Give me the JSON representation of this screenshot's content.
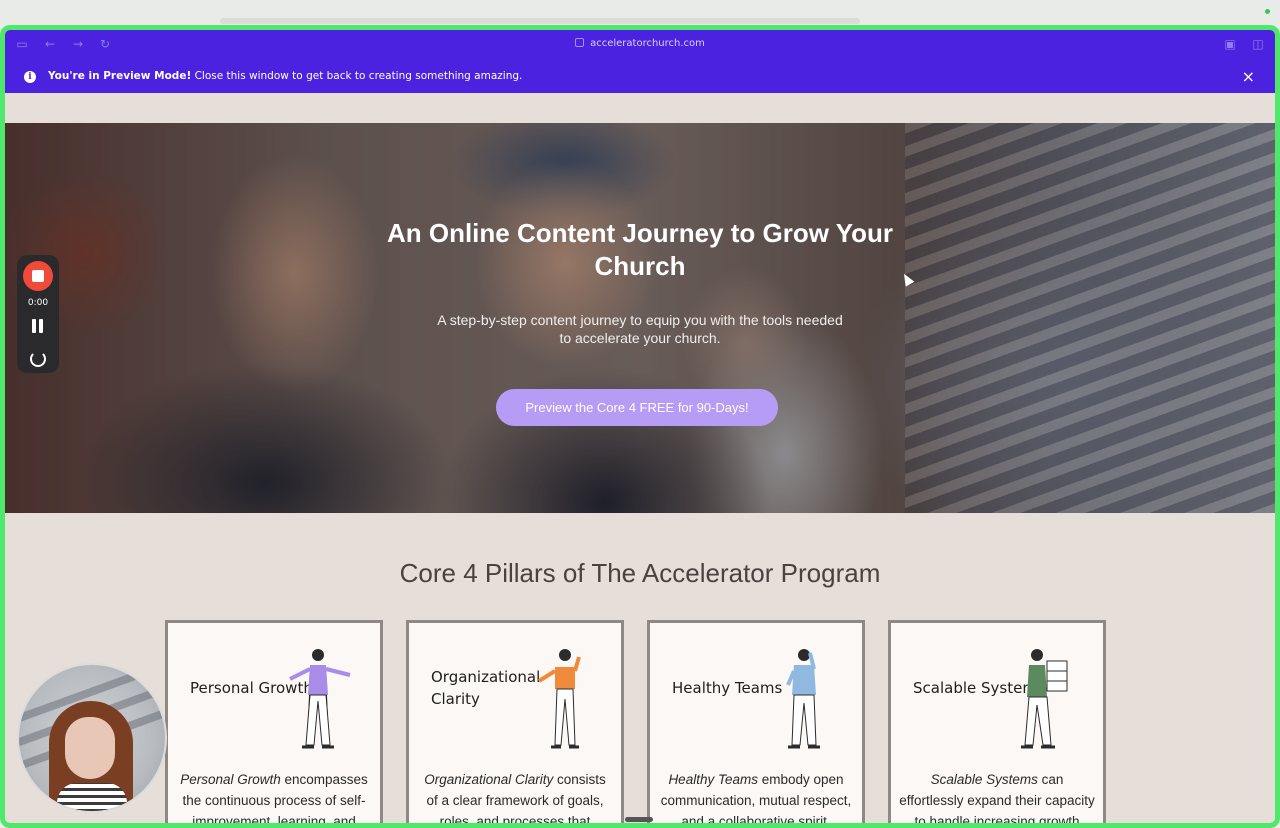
{
  "browser": {
    "url": "acceleratorchurch.com",
    "icons": [
      "sidebar-icon",
      "back-icon",
      "forward-icon",
      "reload-icon",
      "share-icon",
      "tabs-icon"
    ]
  },
  "preview_banner": {
    "bold": "You're in Preview Mode!",
    "text": " Close this window to get back to creating something amazing.",
    "close": "×"
  },
  "hero": {
    "title": "An Online Content Journey to Grow Your Church",
    "subtitle": "A step-by-step content journey to equip you with the tools needed to accelerate your church.",
    "cta": "Preview the Core 4 FREE for 90-Days!"
  },
  "pillars": {
    "title": "Core 4 Pillars of The Accelerator Program",
    "cards": [
      {
        "title": "Personal Growth",
        "desc_italic": "Personal Growth",
        "desc_rest": " encompasses the continuous process of self-improvement, learning, and",
        "accent": "#a98be8"
      },
      {
        "title": "Organizational Clarity",
        "desc_italic": "Organizational Clarity",
        "desc_rest": " consists of a clear framework of goals, roles, and processes that minimizes",
        "accent": "#ef8a3a"
      },
      {
        "title": "Healthy Teams",
        "desc_italic": "Healthy Teams",
        "desc_rest": " embody open communication, mutual respect, and a collaborative spirit, fostering",
        "accent": "#8fb9e0"
      },
      {
        "title": "Scalable Systems",
        "desc_italic": "Scalable Systems",
        "desc_rest": " can effortlessly expand their capacity to handle increasing growth without",
        "accent": "#5a8a5e"
      }
    ]
  },
  "recorder": {
    "time": "0:00"
  },
  "colors": {
    "brand": "#4a22e0",
    "cta": "#b79cf5",
    "frame": "#4ee86a",
    "page_bg": "#e6dfd9"
  }
}
